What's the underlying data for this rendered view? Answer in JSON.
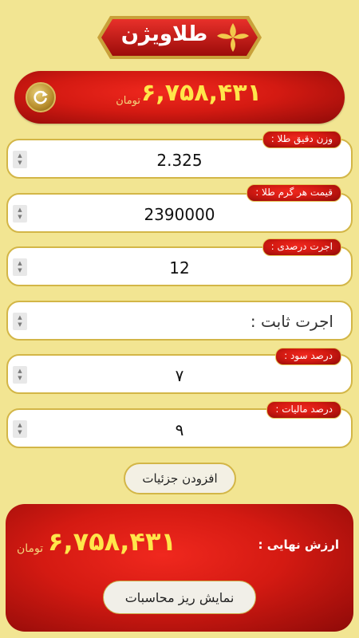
{
  "brand": {
    "logo_text": "طلاویژن",
    "colors": {
      "background": "#f2e592",
      "red": "#d41a12",
      "gold": "#ffe64a"
    }
  },
  "summary": {
    "amount": "۶,۷۵۸,۴۳۱",
    "unit": "تومان",
    "refresh_icon": "refresh-icon"
  },
  "fields": {
    "weight": {
      "label": "وزن دقیق طلا :",
      "value": "2.325"
    },
    "price": {
      "label": "قیمت هر گرم طلا :",
      "value": "2390000"
    },
    "wage_percent": {
      "label": "اجرت درصدی :",
      "value": "12"
    },
    "fixed_wage": {
      "placeholder": "اجرت ثابت :"
    },
    "profit": {
      "label": "درصد سود :",
      "value": "۷"
    },
    "tax": {
      "label": "درصد مالیات :",
      "value": "۹"
    }
  },
  "details_button": "افزودن جزئیات",
  "result": {
    "label": "ارزش نهایی :",
    "amount": "۶,۷۵۸,۴۳۱",
    "unit": "تومان",
    "breakdown_button": "نمایش ریز محاسبات"
  }
}
